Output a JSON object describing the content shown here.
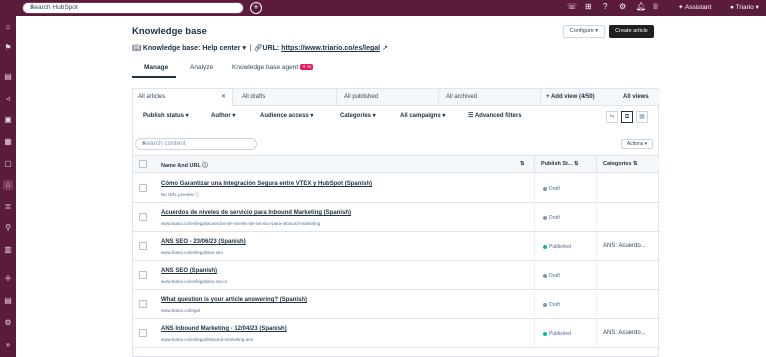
{
  "topbar": {
    "search_placeholder": "Search HubSpot",
    "plus_icon": "plus-icon",
    "assistant_label": "Assistant",
    "user_name": "Triario",
    "notification_count": "4"
  },
  "page": {
    "title": "Knowledge base",
    "kb_label": "Knowledge base:",
    "kb_value": "Help center",
    "url_label": "URL:",
    "url_value": "https://www.triario.co/es/legal",
    "configure_label": "Configure",
    "create_label": "Create article"
  },
  "tabs": {
    "manage": "Manage",
    "analyze": "Analyze",
    "agent": "Knowledge base agent",
    "ai_badge": "AI"
  },
  "views": {
    "all_articles": "All articles",
    "all_drafts": "All drafts",
    "all_published": "All published",
    "all_archived": "All archived",
    "add_view": "Add view (4/50)",
    "all_views": "All views"
  },
  "filters": {
    "publish_status": "Publish status",
    "author": "Author",
    "audience_access": "Audience access",
    "categories": "Categories",
    "all_campaigns": "All campaigns",
    "advanced": "Advanced filters"
  },
  "table": {
    "search_placeholder": "Search content",
    "actions_label": "Actions",
    "col_name": "Name And URL",
    "col_status": "Publish St...",
    "col_categories": "Categories",
    "rows": [
      {
        "name": "Cómo Garantizar una Integración Segura entre VTEX y HubSpot",
        "lang": "(Spanish)",
        "url": "No URL preview",
        "status": "Draft",
        "category": ""
      },
      {
        "name": "Acuerdos de niveles de servicio para Inbound Marketing",
        "lang": "(Spanish)",
        "url": "www.triario.co/es/legal/acuerdos-de-niveles-de-servicio-para-inbound-marketing",
        "status": "Draft",
        "category": ""
      },
      {
        "name": "ANS SEO - 23/06/23",
        "lang": "(Spanish)",
        "url": "www.triario.co/es/legal/ans-seo",
        "status": "Published",
        "category": "ANS: Acuerdo..."
      },
      {
        "name": "ANS SEO",
        "lang": "(Spanish)",
        "url": "www.triario.co/es/legal/ans-seo-2",
        "status": "Draft",
        "category": ""
      },
      {
        "name": "What question is your article answering?",
        "lang": "(Spanish)",
        "url": "www.triario.co/legal",
        "status": "Draft",
        "category": ""
      },
      {
        "name": "ANS Inbound Marketing - 12/04/23",
        "lang": "(Spanish)",
        "url": "www.triario.co/es/legal/inbound-marketing-ans",
        "status": "Published",
        "category": "ANS: Acuerdo..."
      }
    ]
  },
  "colors": {
    "nav": "#5b1b3a",
    "draft_dot": "#7c98b6",
    "published_dot": "#00bda5"
  }
}
